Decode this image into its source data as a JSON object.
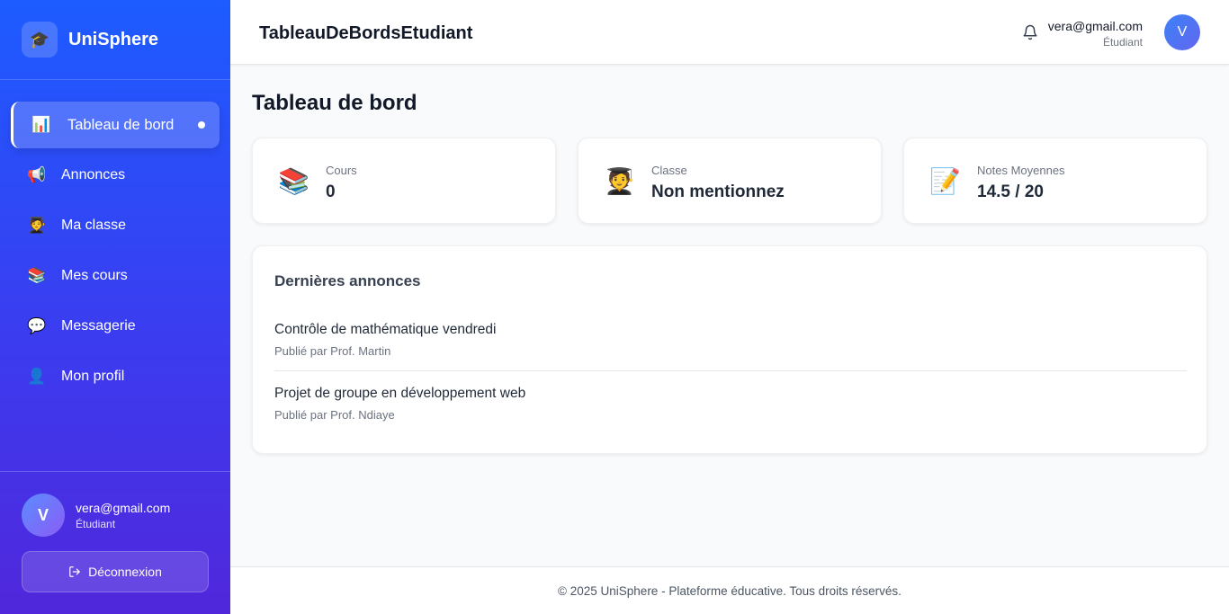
{
  "sidebar": {
    "brand": {
      "logo_icon": "graduation-cap-icon",
      "logo_glyph": "🎓",
      "name": "UniSphere"
    },
    "items": [
      {
        "label": "Tableau de bord",
        "icon": "chart-icon",
        "glyph": "📊",
        "active": true
      },
      {
        "label": "Annonces",
        "icon": "megaphone-icon",
        "glyph": "📢"
      },
      {
        "label": "Ma classe",
        "icon": "student-icon",
        "glyph": "🧑‍🎓"
      },
      {
        "label": "Mes cours",
        "icon": "books-icon",
        "glyph": "📚"
      },
      {
        "label": "Messagerie",
        "icon": "chat-bubble-icon",
        "glyph": "💬"
      },
      {
        "label": "Mon profil",
        "icon": "person-icon",
        "glyph": "👤"
      }
    ],
    "user": {
      "avatar_initial": "V",
      "email": "vera@gmail.com",
      "role": "Étudiant"
    },
    "logout_label": "Déconnexion"
  },
  "header": {
    "title": "TableauDeBordsEtudiant",
    "user": {
      "email": "vera@gmail.com",
      "role": "Étudiant",
      "avatar_initial": "V"
    }
  },
  "main": {
    "title": "Tableau de bord",
    "stats": [
      {
        "label": "Cours",
        "value": "0",
        "icon": "books-icon",
        "glyph": "📚"
      },
      {
        "label": "Classe",
        "value": "Non mentionnez",
        "icon": "student-icon",
        "glyph": "🧑‍🎓"
      },
      {
        "label": "Notes Moyennes",
        "value": "14.5 / 20",
        "icon": "memo-icon",
        "glyph": "📝"
      }
    ],
    "announcements": {
      "title": "Dernières annonces",
      "items": [
        {
          "title": "Contrôle de mathématique vendredi",
          "author": "Publié par Prof. Martin"
        },
        {
          "title": "Projet de groupe en développement web",
          "author": "Publié par Prof. Ndiaye"
        }
      ]
    }
  },
  "footer": {
    "text": "© 2025 UniSphere - Plateforme éducative. Tous droits réservés."
  },
  "colors": {
    "sidebar_top": "#1d5cff",
    "sidebar_bottom": "#5127db",
    "background": "#f8fafc",
    "avatar": "#4f6ef5"
  }
}
